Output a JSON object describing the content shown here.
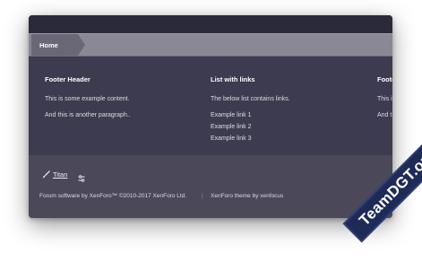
{
  "breadcrumb": {
    "home_label": "Home"
  },
  "footer": {
    "columns": [
      {
        "header": "Footer Header",
        "paragraphs": [
          "This is some example content.",
          "And this is another paragraph.."
        ]
      },
      {
        "header": "List with links",
        "paragraphs": [
          "The below list contains links."
        ],
        "links": [
          "Example link 1",
          "Example link 2",
          "Example link 3"
        ]
      },
      {
        "header": "Foote",
        "paragraphs": [
          "This i",
          "And t"
        ]
      }
    ],
    "style_chooser_label": "Titan",
    "copyright": "Forum software by XenForo™ ©2010-2017 XenForo Ltd.",
    "separator": "|",
    "theme_credit": "XenForo theme by xenfocus"
  },
  "watermark": {
    "text": "TeamDGT.org"
  },
  "colors": {
    "window_bg": "#3d3b4f",
    "breadcrumb_bg": "#8a8894",
    "crumb_bg": "#6a6876",
    "footer_bottom_bg": "#4a4859",
    "watermark_bg": "#1e2b56"
  }
}
